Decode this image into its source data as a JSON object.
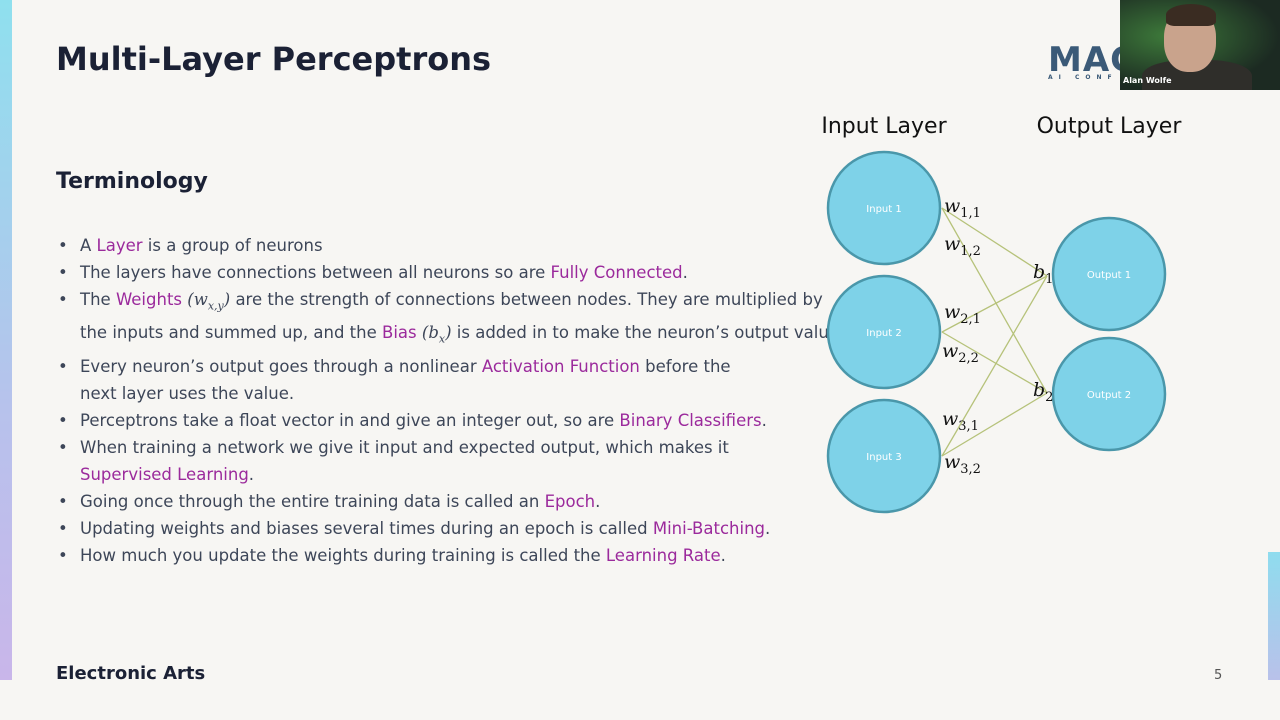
{
  "slide": {
    "title": "Multi-Layer Perceptrons",
    "subtitle": "Terminology",
    "footer": "Electronic Arts",
    "page_number": "5",
    "logo_text": "MAC",
    "logo_sub": "AI CONF"
  },
  "webcam": {
    "name": "Alan Wolfe"
  },
  "bullets": [
    {
      "pre": "A ",
      "term": "Layer",
      "post": " is a group of neurons"
    },
    {
      "pre": "The layers have connections between all neurons so are ",
      "term": "Fully Connected",
      "post": "."
    },
    {
      "pre": "The ",
      "term": "Weights",
      "math1": "w",
      "math1_sub": "x,y",
      "mid": " are the strength of connections between nodes. They are multiplied by the inputs and summed up, and the ",
      "term2": "Bias",
      "math2": "b",
      "math2_sub": "x",
      "post": " is added in to make the neuron’s output value."
    },
    {
      "pre": "Every neuron’s output goes through a nonlinear ",
      "term": "Activation Function",
      "post": " before the next layer uses the value."
    },
    {
      "pre": "Perceptrons take a float vector in and give an integer out, so are ",
      "term": "Binary Classifiers",
      "post": "."
    },
    {
      "pre": "When training a network we give it input and expected output, which makes it ",
      "term": "Supervised Learning",
      "post": "."
    },
    {
      "pre": "Going once through the entire training data is called an ",
      "term": "Epoch",
      "post": "."
    },
    {
      "pre": "Updating weights and biases several times during an epoch is called ",
      "term": "Mini-Batching",
      "post": "."
    },
    {
      "pre": "How much you update the weights during training is called the ",
      "term": "Learning Rate",
      "post": "."
    }
  ],
  "diagram": {
    "input_layer_label": "Input Layer",
    "output_layer_label": "Output Layer",
    "inputs": [
      "Input 1",
      "Input 2",
      "Input 3"
    ],
    "outputs": [
      "Output 1",
      "Output 2"
    ],
    "weights": [
      {
        "sym": "w",
        "sub": "1,1"
      },
      {
        "sym": "w",
        "sub": "1,2"
      },
      {
        "sym": "w",
        "sub": "2,1"
      },
      {
        "sym": "w",
        "sub": "2,2"
      },
      {
        "sym": "w",
        "sub": "3,1"
      },
      {
        "sym": "w",
        "sub": "3,2"
      }
    ],
    "biases": [
      {
        "sym": "b",
        "sub": "1"
      },
      {
        "sym": "b",
        "sub": "2"
      }
    ]
  },
  "colors": {
    "highlight": "#9b2a9c",
    "node_fill": "#7ed2e8",
    "node_stroke": "#4a97aa",
    "edge": "#b6c27a"
  }
}
